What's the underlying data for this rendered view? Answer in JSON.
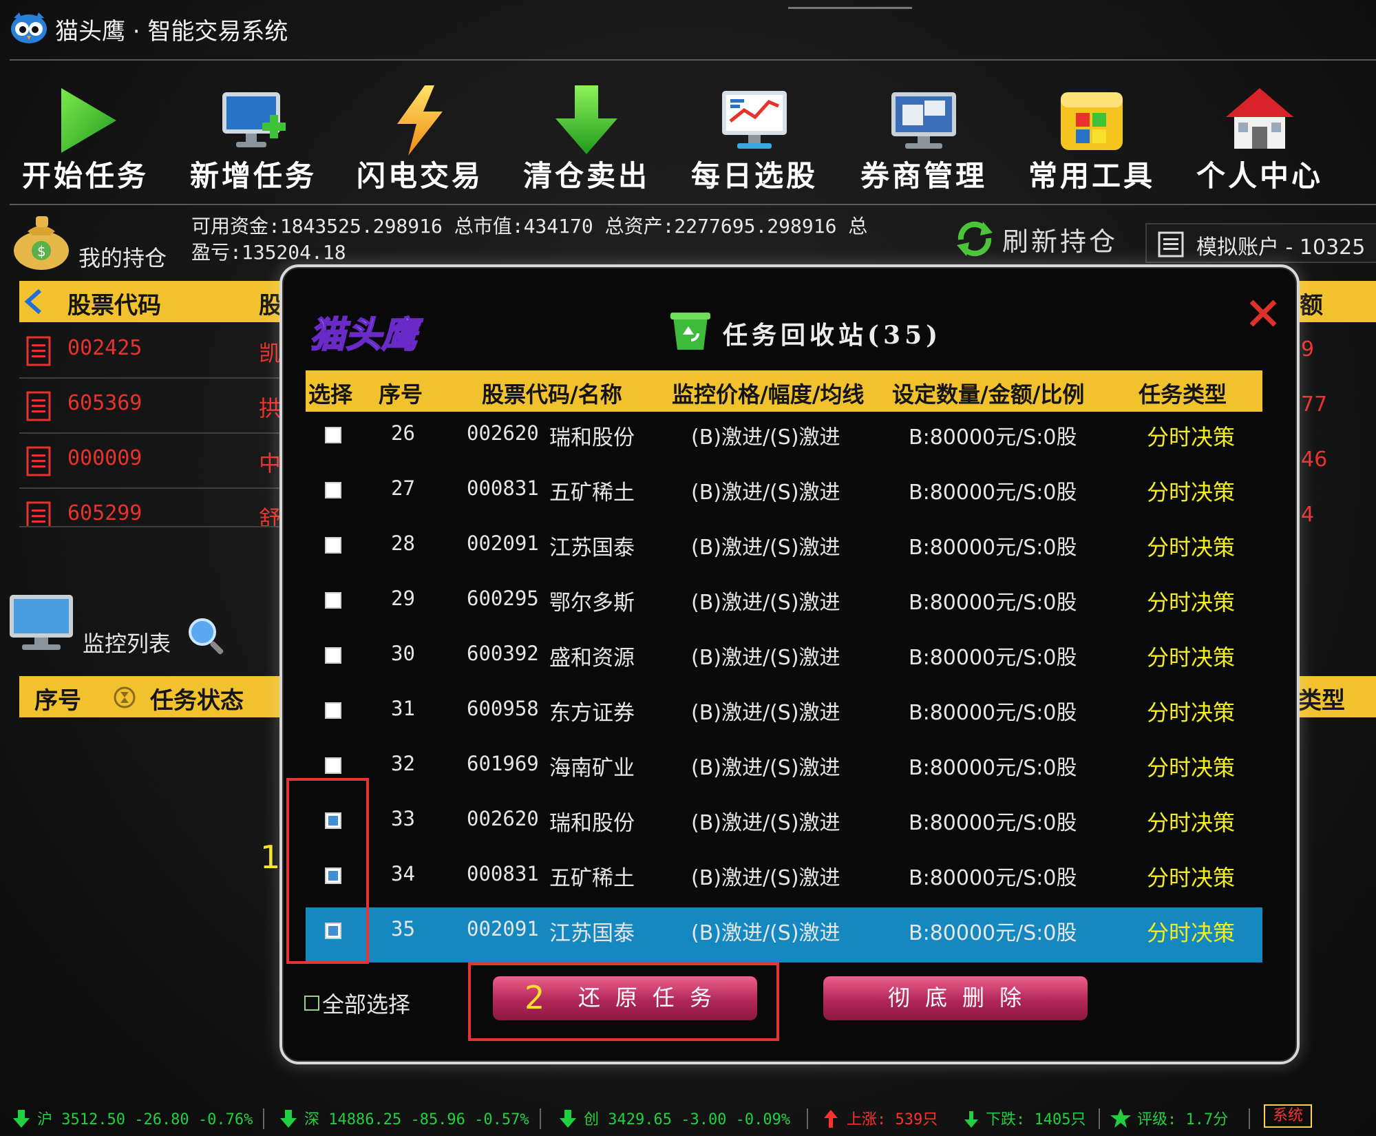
{
  "app": {
    "title": "猫头鹰 · 智能交易系统"
  },
  "toolbar": [
    {
      "label": "开始任务",
      "icon": "play-icon"
    },
    {
      "label": "新增任务",
      "icon": "add-monitor-icon"
    },
    {
      "label": "闪电交易",
      "icon": "lightning-icon"
    },
    {
      "label": "清仓卖出",
      "icon": "down-arrow-icon"
    },
    {
      "label": "每日选股",
      "icon": "chart-screen-icon"
    },
    {
      "label": "券商管理",
      "icon": "broker-screen-icon"
    },
    {
      "label": "常用工具",
      "icon": "tools-folder-icon"
    },
    {
      "label": "个人中心",
      "icon": "home-icon"
    }
  ],
  "holdings": {
    "label": "我的持仓",
    "summary_line1": "可用资金:1843525.298916 总市值:434170 总资产:2277695.298916 总",
    "summary_line2": "盈亏:135204.18",
    "refresh_label": "刷新持仓",
    "account_label": "模拟账户 - 10325",
    "header_code": "股票代码",
    "header_name": "股",
    "header_right": "额",
    "rows": [
      {
        "code": "002425",
        "name": "凯",
        "right": "9"
      },
      {
        "code": "605369",
        "name": "拱",
        "right": "77"
      },
      {
        "code": "000009",
        "name": "中",
        "right": "46"
      },
      {
        "code": "605299",
        "name": "舒",
        "right": "4"
      }
    ]
  },
  "monitor": {
    "label": "监控列表",
    "header_seq": "序号",
    "header_status": "任务状态",
    "header_right": "类型"
  },
  "modal": {
    "title": "任务回收站(35)",
    "brand": "猫头鹰",
    "columns": [
      "选择",
      "序号",
      "股票代码/名称",
      "监控价格/幅度/均线",
      "设定数量/金额/比例",
      "任务类型"
    ],
    "rows": [
      {
        "seq": "26",
        "code": "002620",
        "name": "瑞和股份",
        "price": "(B)激进/(S)激进",
        "qty": "B:80000元/S:0股",
        "type": "分时决策",
        "checked": false,
        "selected": false
      },
      {
        "seq": "27",
        "code": "000831",
        "name": "五矿稀土",
        "price": "(B)激进/(S)激进",
        "qty": "B:80000元/S:0股",
        "type": "分时决策",
        "checked": false,
        "selected": false
      },
      {
        "seq": "28",
        "code": "002091",
        "name": "江苏国泰",
        "price": "(B)激进/(S)激进",
        "qty": "B:80000元/S:0股",
        "type": "分时决策",
        "checked": false,
        "selected": false
      },
      {
        "seq": "29",
        "code": "600295",
        "name": "鄂尔多斯",
        "price": "(B)激进/(S)激进",
        "qty": "B:80000元/S:0股",
        "type": "分时决策",
        "checked": false,
        "selected": false
      },
      {
        "seq": "30",
        "code": "600392",
        "name": "盛和资源",
        "price": "(B)激进/(S)激进",
        "qty": "B:80000元/S:0股",
        "type": "分时决策",
        "checked": false,
        "selected": false
      },
      {
        "seq": "31",
        "code": "600958",
        "name": "东方证券",
        "price": "(B)激进/(S)激进",
        "qty": "B:80000元/S:0股",
        "type": "分时决策",
        "checked": false,
        "selected": false
      },
      {
        "seq": "32",
        "code": "601969",
        "name": "海南矿业",
        "price": "(B)激进/(S)激进",
        "qty": "B:80000元/S:0股",
        "type": "分时决策",
        "checked": false,
        "selected": false
      },
      {
        "seq": "33",
        "code": "002620",
        "name": "瑞和股份",
        "price": "(B)激进/(S)激进",
        "qty": "B:80000元/S:0股",
        "type": "分时决策",
        "checked": true,
        "selected": false
      },
      {
        "seq": "34",
        "code": "000831",
        "name": "五矿稀土",
        "price": "(B)激进/(S)激进",
        "qty": "B:80000元/S:0股",
        "type": "分时决策",
        "checked": true,
        "selected": false
      },
      {
        "seq": "35",
        "code": "002091",
        "name": "江苏国泰",
        "price": "(B)激进/(S)激进",
        "qty": "B:80000元/S:0股",
        "type": "分时决策",
        "checked": true,
        "selected": true
      }
    ],
    "select_all_label": "全部选择",
    "restore_label": "还原任务",
    "delete_label": "彻底删除",
    "annotation_1": "1",
    "annotation_2": "2"
  },
  "statusbar": {
    "sh": "沪 3512.50 -26.80 -0.76%",
    "sz": "深 14886.25 -85.96 -0.57%",
    "cy": "创 3429.65 -3.00 -0.09%",
    "up": "上涨: 539只",
    "down": "下跌: 1405只",
    "rating": "评级: 1.7分",
    "system": "系统"
  },
  "colors": {
    "header_yellow": "#f2c12e",
    "selected_row": "#1688c0",
    "type_yellow": "#f4ee1a",
    "annotation_red": "#e43434",
    "stock_red": "#e8322e",
    "market_green": "#20d040"
  }
}
